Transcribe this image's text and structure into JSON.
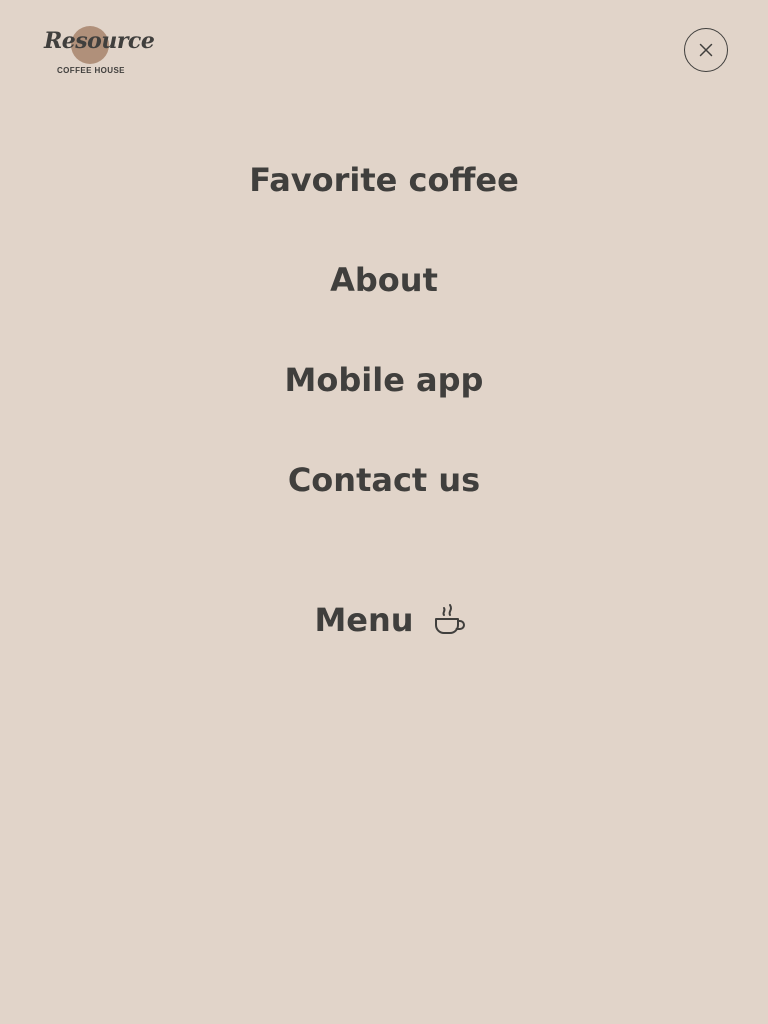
{
  "logo": {
    "word": "Resource",
    "subtitle": "COFFEE HOUSE",
    "circle_color": "#b0907a"
  },
  "close": {
    "icon": "close-icon"
  },
  "nav": {
    "items": [
      {
        "label": "Favorite coffee"
      },
      {
        "label": "About"
      },
      {
        "label": "Mobile app"
      },
      {
        "label": "Contact us"
      }
    ],
    "menu": {
      "label": "Menu",
      "icon": "coffee-cup-icon"
    }
  },
  "colors": {
    "background": "#e1d4c9",
    "text": "#403f3d",
    "accent": "#b0907a"
  }
}
